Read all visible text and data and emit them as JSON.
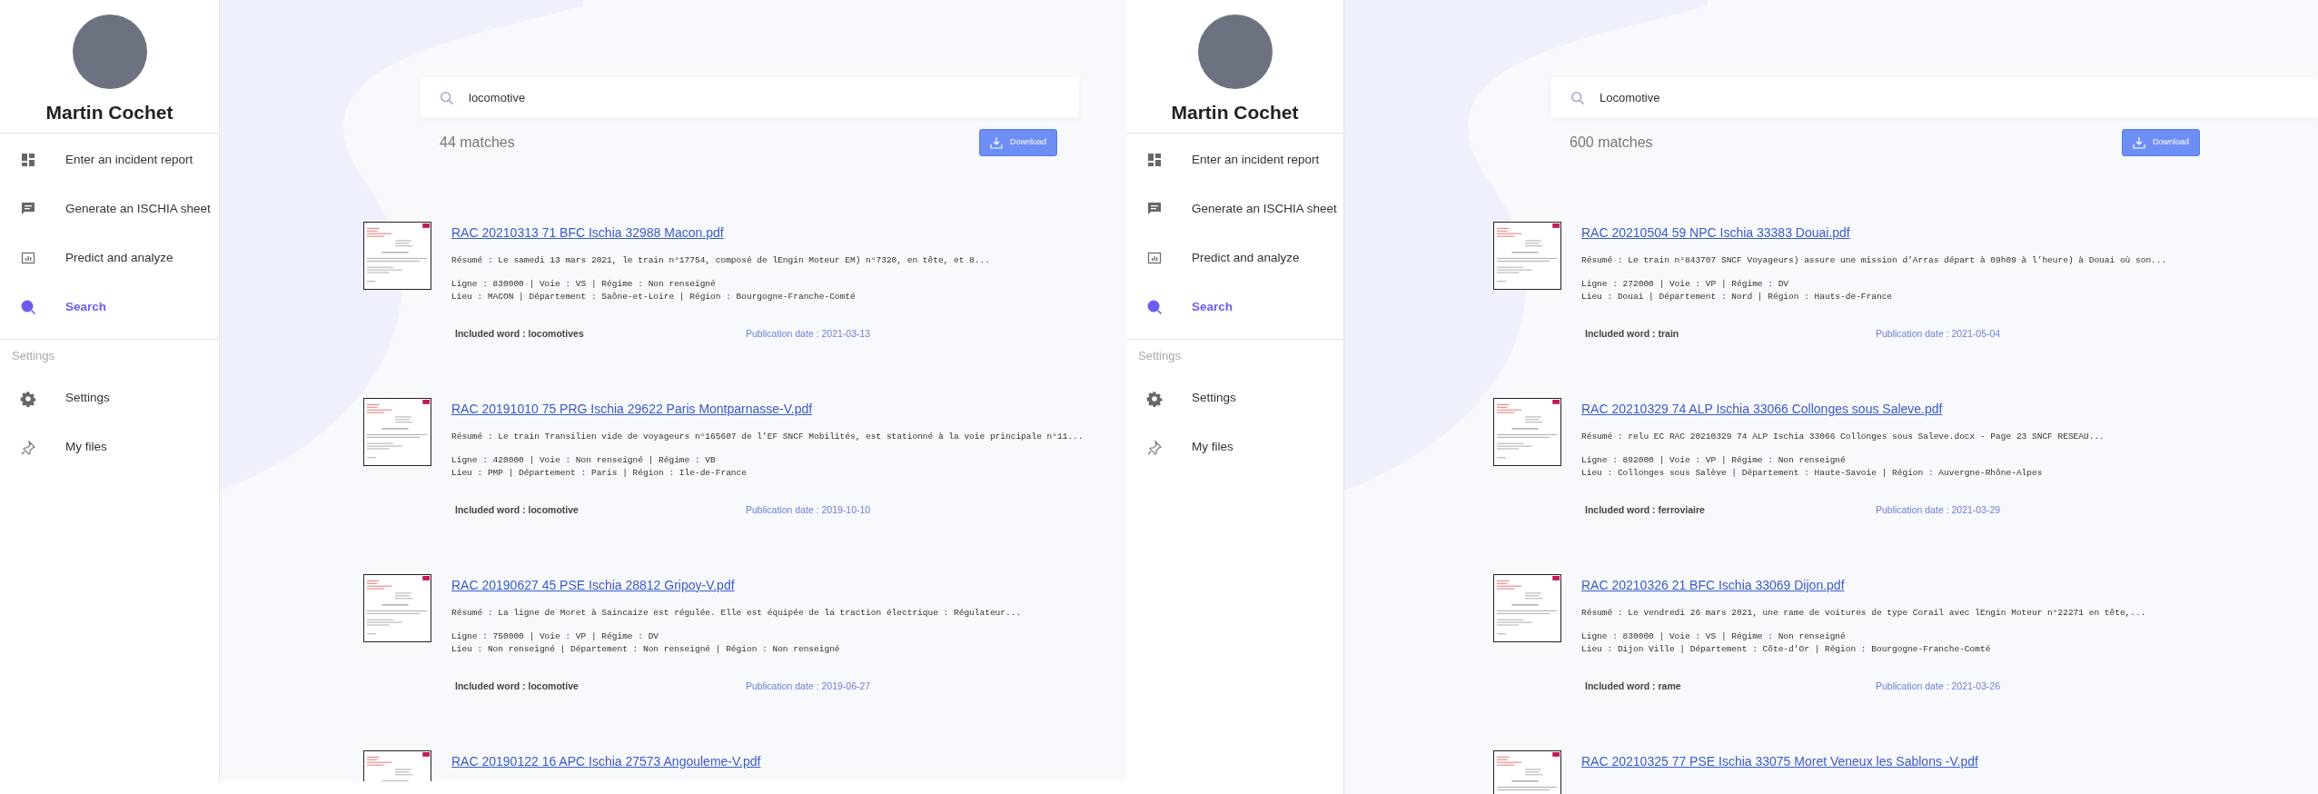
{
  "panels": [
    {
      "sidebar": {
        "user_name": "Martin Cochet",
        "nav": [
          {
            "label": "Enter an incident report",
            "selected": false
          },
          {
            "label": "Generate an ISCHIA sheet",
            "selected": false
          },
          {
            "label": "Predict and analyze",
            "selected": false
          },
          {
            "label": "Search",
            "selected": true
          }
        ],
        "section_label": "Settings",
        "settings_items": [
          {
            "label": "Settings"
          },
          {
            "label": "My files"
          }
        ]
      },
      "search": {
        "value": "locomotive"
      },
      "matches": "44 matches",
      "download_label": "Download",
      "results": [
        {
          "title": "RAC 20210313 71 BFC Ischia 32988 Macon.pdf",
          "summary": "Résumé : Le samedi 13 mars 2021, le train n°17754, composé de lEngin Moteur EM) n°7320, en tête, et 8...",
          "line_info": "Ligne : 830000 | Voie : VS | Régime : Non renseigné",
          "place_info": "Lieu : MACON | Département : Saône-et-Loire | Région : Bourgogne-Franche-Comté",
          "included_word": "Included word : locomotives",
          "publication_date": "Publication date : 2021-03-13"
        },
        {
          "title": "RAC 20191010 75 PRG Ischia 29622 Paris Montparnasse-V.pdf",
          "summary": "Résumé : Le train Transilien vide de voyageurs n°165607 de l’EF SNCF Mobilités, est stationné à la voie principale n°11...",
          "line_info": "Ligne : 420000 | Voie : Non renseigné | Régime : VB",
          "place_info": "Lieu : PMP | Département : Paris | Région : Ile-de-France",
          "included_word": "Included word : locomotive",
          "publication_date": "Publication date : 2019-10-10"
        },
        {
          "title": "RAC 20190627 45 PSE Ischia 28812 Gripoy-V.pdf",
          "summary": "Résumé : La ligne de Moret à Saincaize est régulée. Elle est équipée de la traction électrique : Régulateur...",
          "line_info": "Ligne : 750000 | Voie : VP | Régime : DV",
          "place_info": "Lieu : Non renseigné | Département : Non renseigné | Région : Non renseigné",
          "included_word": "Included word : locomotive",
          "publication_date": "Publication date : 2019-06-27"
        },
        {
          "title": "RAC 20190122 16 APC Ischia 27573 Angouleme-V.pdf"
        }
      ]
    },
    {
      "sidebar": {
        "user_name": "Martin Cochet",
        "nav": [
          {
            "label": "Enter an incident report",
            "selected": false
          },
          {
            "label": "Generate an ISCHIA sheet",
            "selected": false
          },
          {
            "label": "Predict and analyze",
            "selected": false
          },
          {
            "label": "Search",
            "selected": true
          }
        ],
        "section_label": "Settings",
        "settings_items": [
          {
            "label": "Settings"
          },
          {
            "label": "My files"
          }
        ]
      },
      "search": {
        "value": "Locomotive"
      },
      "matches": "600 matches",
      "download_label": "Download",
      "results": [
        {
          "title": "RAC 20210504 59 NPC Ischia 33383 Douai.pdf",
          "summary": "Résumé : Le train n°843707 SNCF Voyageurs) assure une mission d’Arras départ à 09h09 à l’heure) à Douai où son...",
          "line_info": "Ligne : 272000 | Voie : VP | Régime : DV",
          "place_info": "Lieu : Douai | Département : Nord | Région : Hauts-de-France",
          "included_word": "Included word : train",
          "publication_date": "Publication date : 2021-05-04"
        },
        {
          "title": "RAC 20210329 74 ALP Ischia 33066 Collonges sous Saleve.pdf",
          "summary": "Résumé : relu EC RAC 20210329 74 ALP Ischia 33066 Collonges sous Saleve.docx - Page 23 SNCF RESEAU...",
          "line_info": "Ligne : 892000 | Voie : VP | Régime : Non renseigné",
          "place_info": "Lieu : Collonges sous Salève | Département : Haute-Savoie | Région : Auvergne-Rhône-Alpes",
          "included_word": "Included word : ferroviaire",
          "publication_date": "Publication date : 2021-03-29"
        },
        {
          "title": "RAC 20210326 21 BFC Ischia 33069 Dijon.pdf",
          "summary": "Résumé : Le vendredi 26 mars 2021, une rame de voitures de type Corail avec lEngin Moteur n°22271 en tête,...",
          "line_info": "Ligne : 830000 | Voie : VS | Régime : Non renseigné",
          "place_info": "Lieu : Dijon Ville | Département : Côte-d'Or | Région : Bourgogne-Franche-Comté",
          "included_word": "Included word : rame",
          "publication_date": "Publication date : 2021-03-26"
        },
        {
          "title": "RAC 20210325 77 PSE Ischia 33075 Moret Veneux les Sablons -V.pdf"
        }
      ]
    }
  ]
}
